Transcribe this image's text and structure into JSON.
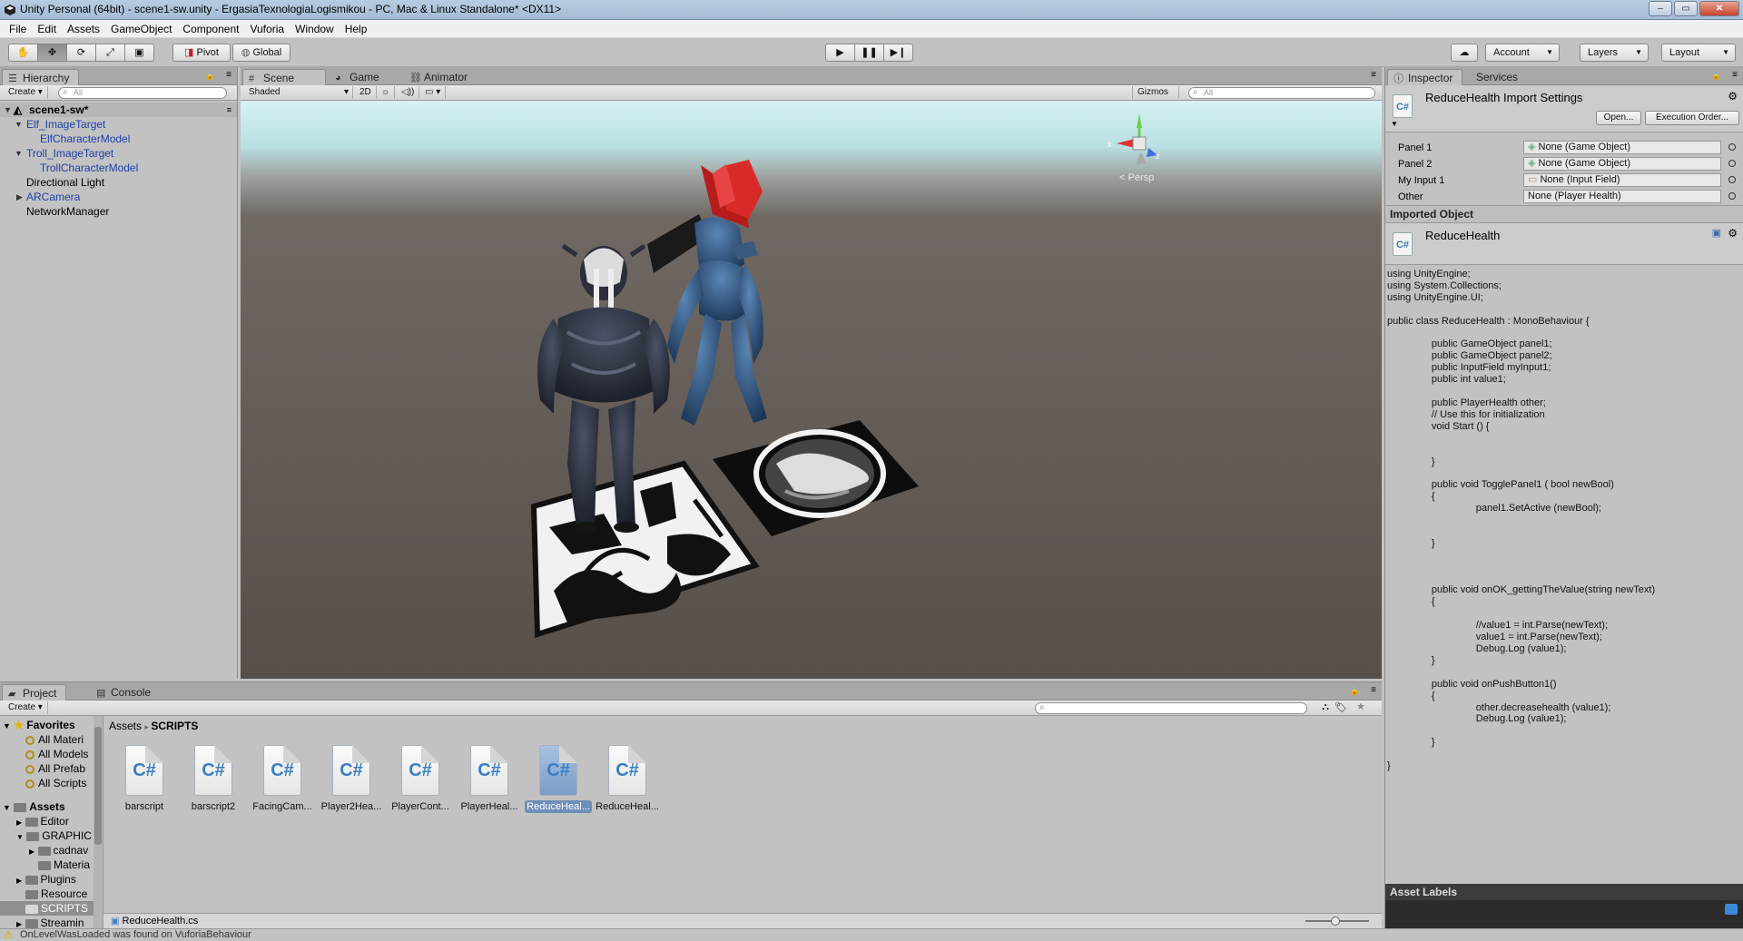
{
  "window": {
    "title": "Unity Personal (64bit) - scene1-sw.unity - ErgasiaTexnologiaLogismikou - PC, Mac & Linux Standalone* <DX11>"
  },
  "menu": [
    "File",
    "Edit",
    "Assets",
    "GameObject",
    "Component",
    "Vuforia",
    "Window",
    "Help"
  ],
  "toolbar": {
    "pivot_label": "Pivot",
    "global_label": "Global",
    "account_label": "Account",
    "layers_label": "Layers",
    "layout_label": "Layout"
  },
  "hierarchy": {
    "tab_label": "Hierarchy",
    "create_label": "Create",
    "search_placeholder": "All",
    "scene_name": "scene1-sw*",
    "items": [
      {
        "label": "Elf_ImageTarget",
        "prefab": true,
        "depth": 1,
        "expanded": true
      },
      {
        "label": "ElfCharacterModel",
        "prefab": true,
        "depth": 2
      },
      {
        "label": "Troll_ImageTarget",
        "prefab": true,
        "depth": 1,
        "expanded": true
      },
      {
        "label": "TrollCharacterModel",
        "prefab": true,
        "depth": 2
      },
      {
        "label": "Directional Light",
        "prefab": false,
        "depth": 1
      },
      {
        "label": "ARCamera",
        "prefab": true,
        "depth": 1,
        "collapsed": true
      },
      {
        "label": "NetworkManager",
        "prefab": false,
        "depth": 1
      }
    ]
  },
  "scene": {
    "tabs": [
      "Scene",
      "Game",
      "Animator"
    ],
    "shading_mode": "Shaded",
    "mode_2d": "2D",
    "gizmos_label": "Gizmos",
    "search_placeholder": "All",
    "persp_label": "Persp",
    "gizmo_axes": {
      "x": "x",
      "z": "z"
    }
  },
  "inspector": {
    "tabs": [
      "Inspector",
      "Services"
    ],
    "title": "ReduceHealth Import Settings",
    "open_button": "Open...",
    "execution_order_button": "Execution Order...",
    "properties": [
      {
        "label": "Panel 1",
        "value": "None (Game Object)"
      },
      {
        "label": "Panel 2",
        "value": "None (Game Object)"
      },
      {
        "label": "My Input 1",
        "value": "None (Input Field)"
      },
      {
        "label": "Other",
        "value": "None (Player Health)"
      }
    ],
    "imported_object_header": "Imported Object",
    "imported_object_name": "ReduceHealth",
    "asset_labels_header": "Asset Labels",
    "code": "using UnityEngine;\nusing System.Collections;\nusing UnityEngine.UI;\n\npublic class ReduceHealth : MonoBehaviour {\n\n\t\tpublic GameObject panel1;\n\t\tpublic GameObject panel2;\n\t\tpublic InputField myInput1;\n\t\tpublic int value1;\n\n\t\tpublic PlayerHealth other;\n\t\t// Use this for initialization\n\t\tvoid Start () {\n\n\n\t\t}\n\n\t\tpublic void TogglePanel1 ( bool newBool)\n\t\t{\n\t\t\t\tpanel1.SetActive (newBool);\n\n\n\t\t}\n\n\n\n\t\tpublic void onOK_gettingTheValue(string newText)\n\t\t{\n\n\t\t\t\t//value1 = int.Parse(newText);\n\t\t\t\tvalue1 = int.Parse(newText);\n\t\t\t\tDebug.Log (value1);\n\t\t}\n\n\t\tpublic void onPushButton1()\n\t\t{\n\t\t\t\tother.decreasehealth (value1);\n\t\t\t\tDebug.Log (value1);\n\n\t\t}\n\n}"
  },
  "project": {
    "tabs": [
      "Project",
      "Console"
    ],
    "create_label": "Create",
    "favorites_label": "Favorites",
    "favorites": [
      "All Materi",
      "All Models",
      "All Prefab",
      "All Scripts"
    ],
    "assets_label": "Assets",
    "asset_tree": [
      {
        "label": "Editor",
        "depth": 1
      },
      {
        "label": "GRAPHIC",
        "depth": 1,
        "expanded": true
      },
      {
        "label": "cadnav",
        "depth": 2
      },
      {
        "label": "Materia",
        "depth": 2
      },
      {
        "label": "Plugins",
        "depth": 1
      },
      {
        "label": "Resource",
        "depth": 1
      },
      {
        "label": "SCRIPTS",
        "depth": 1,
        "selected": true
      },
      {
        "label": "Streamin",
        "depth": 1
      }
    ],
    "breadcrumb_root": "Assets",
    "breadcrumb_current": "SCRIPTS",
    "assets": [
      {
        "name": "barscript"
      },
      {
        "name": "barscript2"
      },
      {
        "name": "FacingCam..."
      },
      {
        "name": "Player2Hea..."
      },
      {
        "name": "PlayerCont..."
      },
      {
        "name": "PlayerHeal..."
      },
      {
        "name": "ReduceHeal...",
        "selected": true
      },
      {
        "name": "ReduceHeal..."
      }
    ],
    "selected_file": "ReduceHealth.cs"
  },
  "status": {
    "message": "OnLevelWasLoaded was found on VuforiaBehaviour"
  },
  "colors": {
    "editor_bg": "#c2c2c2",
    "prefab_blue": "#1d3fa8",
    "selection_blue": "#6e8fb8",
    "sky_top": "#d9f1f3",
    "ground": "#5e5651",
    "troll_body": "#2f4f74",
    "troll_hair": "#d11c1c",
    "elf_body": "#2a2f3d"
  }
}
